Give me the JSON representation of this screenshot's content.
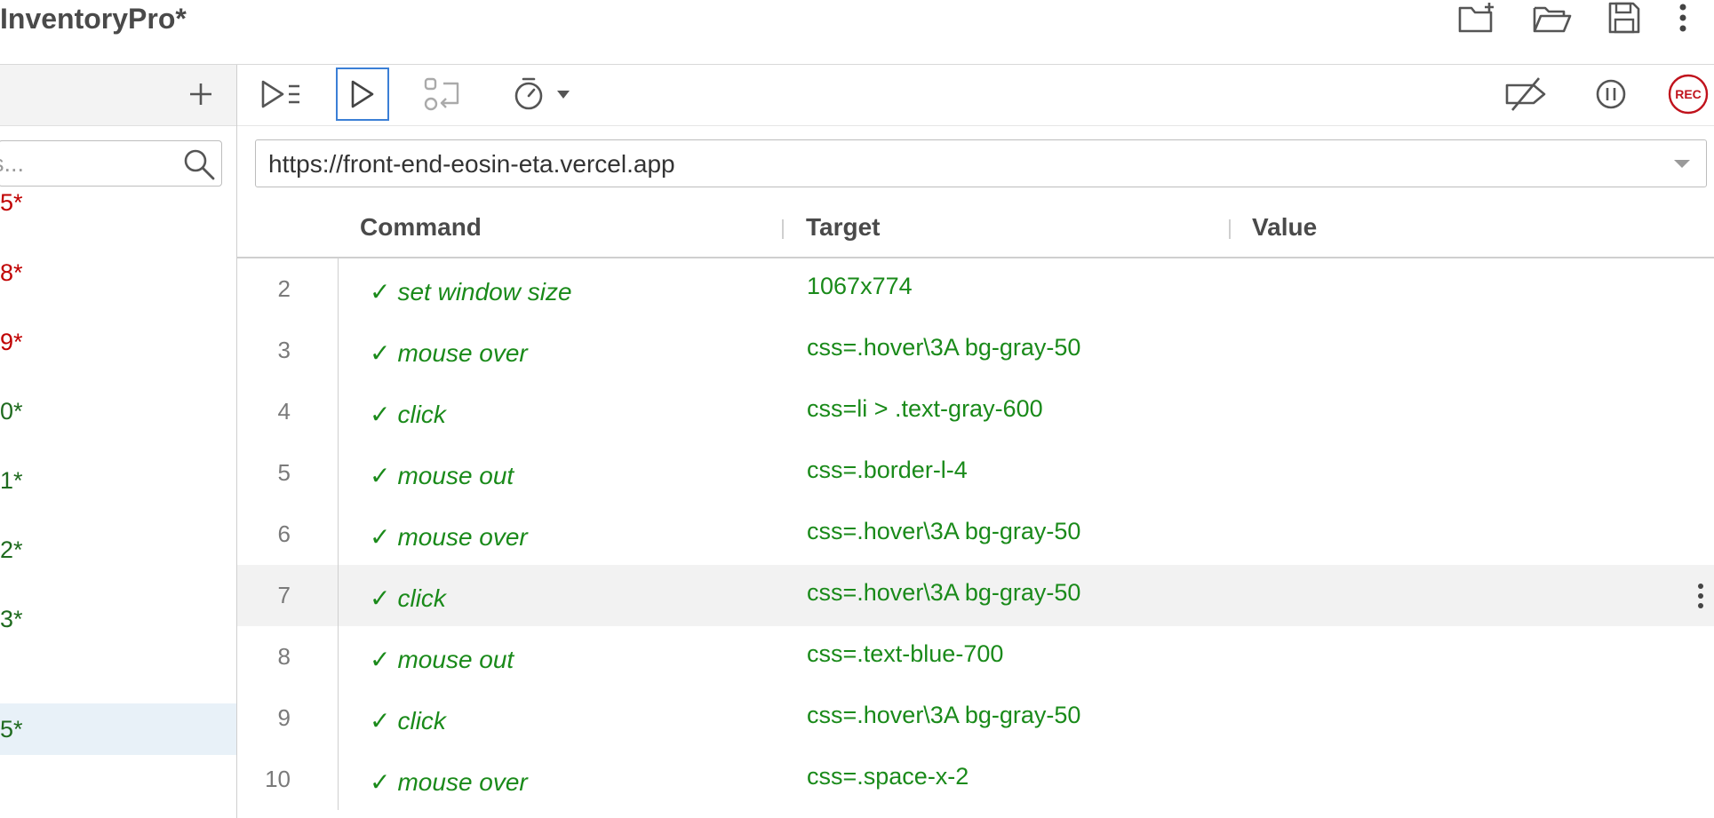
{
  "app": {
    "title": "InventoryPro*"
  },
  "header_icons": [
    "new-folder-icon",
    "open-folder-icon",
    "save-icon",
    "more-vertical-icon"
  ],
  "sidebar": {
    "search_placeholder": "s...",
    "items": [
      {
        "label": "5*",
        "color": "red"
      },
      {
        "label": "8*",
        "color": "red"
      },
      {
        "label": "9*",
        "color": "red"
      },
      {
        "label": "0*",
        "color": "green"
      },
      {
        "label": "1*",
        "color": "green"
      },
      {
        "label": "2*",
        "color": "green"
      },
      {
        "label": "3*",
        "color": "green"
      },
      {
        "label": "5*",
        "color": "green",
        "selected": true
      }
    ]
  },
  "toolbar": {
    "icons": [
      "run-all-icon",
      "run-current-icon",
      "step-icon",
      "speed-icon",
      "disable-breakpoints-icon",
      "pause-icon",
      "record-icon"
    ],
    "record_label": "REC"
  },
  "url_bar": {
    "value": "https://front-end-eosin-eta.vercel.app"
  },
  "table": {
    "headers": {
      "command": "Command",
      "target": "Target",
      "value": "Value"
    },
    "rows": [
      {
        "num": "2",
        "command": "set window size",
        "target": "1067x774",
        "value": ""
      },
      {
        "num": "3",
        "command": "mouse over",
        "target": "css=.hover\\3A bg-gray-50",
        "value": ""
      },
      {
        "num": "4",
        "command": "click",
        "target": "css=li > .text-gray-600",
        "value": ""
      },
      {
        "num": "5",
        "command": "mouse out",
        "target": "css=.border-l-4",
        "value": ""
      },
      {
        "num": "6",
        "command": "mouse over",
        "target": "css=.hover\\3A bg-gray-50",
        "value": ""
      },
      {
        "num": "7",
        "command": "click",
        "target": "css=.hover\\3A bg-gray-50",
        "value": "",
        "selected": true
      },
      {
        "num": "8",
        "command": "mouse out",
        "target": "css=.text-blue-700",
        "value": ""
      },
      {
        "num": "9",
        "command": "click",
        "target": "css=.hover\\3A bg-gray-50",
        "value": ""
      },
      {
        "num": "10",
        "command": "mouse over",
        "target": "css=.space-x-2",
        "value": ""
      }
    ],
    "check_mark": "✓"
  },
  "colors": {
    "accent": "#3b7fd6",
    "success_text": "#1a8a1a",
    "error_text": "#c00000",
    "record": "#c0121c"
  }
}
